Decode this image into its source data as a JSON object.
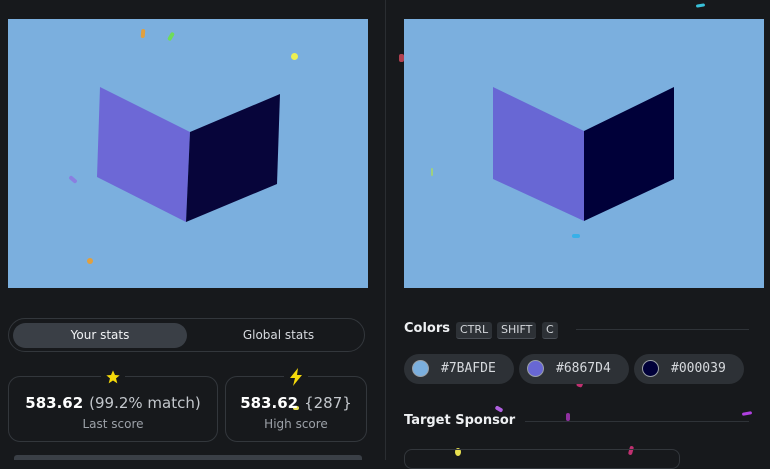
{
  "game": {
    "target_colors": [
      "#7BAFDE",
      "#6867D4",
      "#000039"
    ],
    "player_colors": [
      "#7BAFDE",
      "#6D68D6",
      "#07053A"
    ]
  },
  "stats": {
    "tabs": [
      {
        "label": "Your stats",
        "active": true
      },
      {
        "label": "Global stats",
        "active": false
      }
    ],
    "last_score": {
      "value": "583.62",
      "detail": "(99.2% match)",
      "caption": "Last score",
      "icon": "star-icon"
    },
    "high_score": {
      "value": "583.62",
      "detail": "{287}",
      "caption": "High score",
      "icon": "lightning-icon"
    }
  },
  "colors_section": {
    "title": "Colors",
    "shortcut_keys": [
      "CTRL",
      "SHIFT",
      "C"
    ],
    "swatches": [
      {
        "hex": "#7BAFDE",
        "color": "#7BAFDE"
      },
      {
        "hex": "#6867D4",
        "color": "#6867D4"
      },
      {
        "hex": "#000039",
        "color": "#000039"
      }
    ]
  },
  "sponsor_section": {
    "title": "Target Sponsor"
  }
}
